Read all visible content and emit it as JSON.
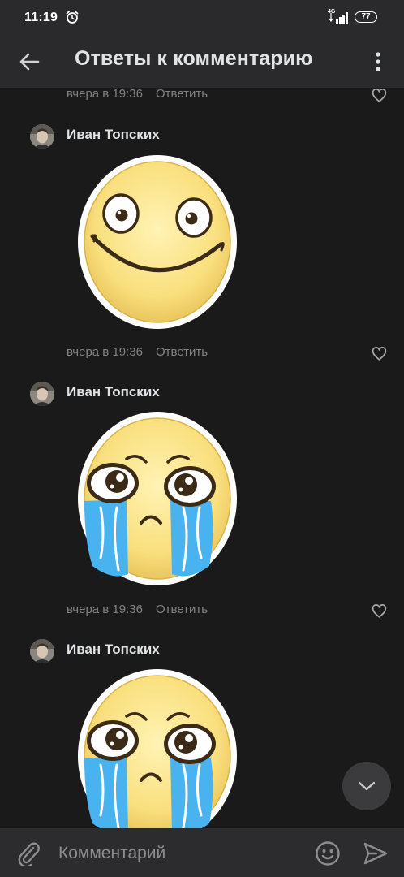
{
  "status_bar": {
    "time": "11:19",
    "network": "4G",
    "battery": "77"
  },
  "app_bar": {
    "title": "Ответы к комментарию"
  },
  "first_meta": {
    "time": "вчера в 19:36",
    "reply": "Ответить"
  },
  "comments": [
    {
      "author": "Иван Топских",
      "sticker": "smiling-emoji-sticker",
      "time": "вчера в 19:36",
      "reply": "Ответить"
    },
    {
      "author": "Иван Топских",
      "sticker": "crying-emoji-sticker",
      "time": "вчера в 19:36",
      "reply": "Ответить"
    },
    {
      "author": "Иван Топских",
      "sticker": "crying-emoji-sticker"
    }
  ],
  "composer": {
    "placeholder": "Комментарий"
  },
  "icons": [
    "alarm-icon",
    "signal-icon",
    "battery-icon",
    "back-arrow-icon",
    "more-vertical-icon",
    "heart-icon",
    "chevron-down-icon",
    "paperclip-icon",
    "emoji-icon",
    "send-icon"
  ],
  "colors": {
    "background": "#1a1a1a",
    "bar": "#2a2a2c",
    "text": "#e1e3e6",
    "muted": "#828282",
    "sticker_face": "#f9df7d",
    "tears": "#49b3f0"
  }
}
